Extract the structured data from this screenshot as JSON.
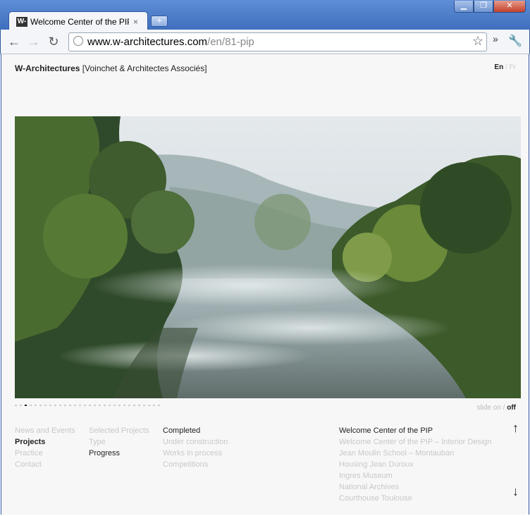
{
  "browser": {
    "tab_title": "Welcome Center of the PIP",
    "tab_favicon": "W-",
    "tab_close": "×",
    "new_tab": "+",
    "url_host": "www.w-architectures.com",
    "url_path": "/en/81-pip",
    "window_min": "▁",
    "window_max": "❐",
    "window_close": "✕",
    "back": "←",
    "forward": "→",
    "reload": "↻",
    "star": "☆",
    "chevron": "»",
    "wrench": "🔧"
  },
  "site": {
    "brand_name": "W-Architectures",
    "brand_sub": "[Voinchet & Architectes Associés]",
    "lang_en": "En",
    "lang_sep": "/",
    "lang_fr": "Fr"
  },
  "slideshow": {
    "dot_count": 30,
    "active_index": 2,
    "label": "slide on /",
    "state": "off"
  },
  "nav": {
    "col1": [
      "News and Events",
      "Projects",
      "Practice",
      "Contact"
    ],
    "col2": [
      "Selected Projects",
      "Type",
      "Progress"
    ],
    "col3": [
      "Completed",
      "Under construction",
      "Works in process",
      "Competitions"
    ],
    "projects": [
      "Welcome Center of the PIP",
      "Welcome Center of the PIP – Interior Design",
      "Jean Moulin School – Montauban",
      "Housing Jean Duroux",
      "Ingres Museum",
      "National Archives",
      "Courthouse Toulouse"
    ],
    "arrow_up": "↑",
    "arrow_down": "↓"
  },
  "colors": {
    "window_frame": "#3f6fbd",
    "page_bg": "#f7f7f7",
    "muted_text": "#c8c8c8",
    "dark_text": "#222222"
  }
}
